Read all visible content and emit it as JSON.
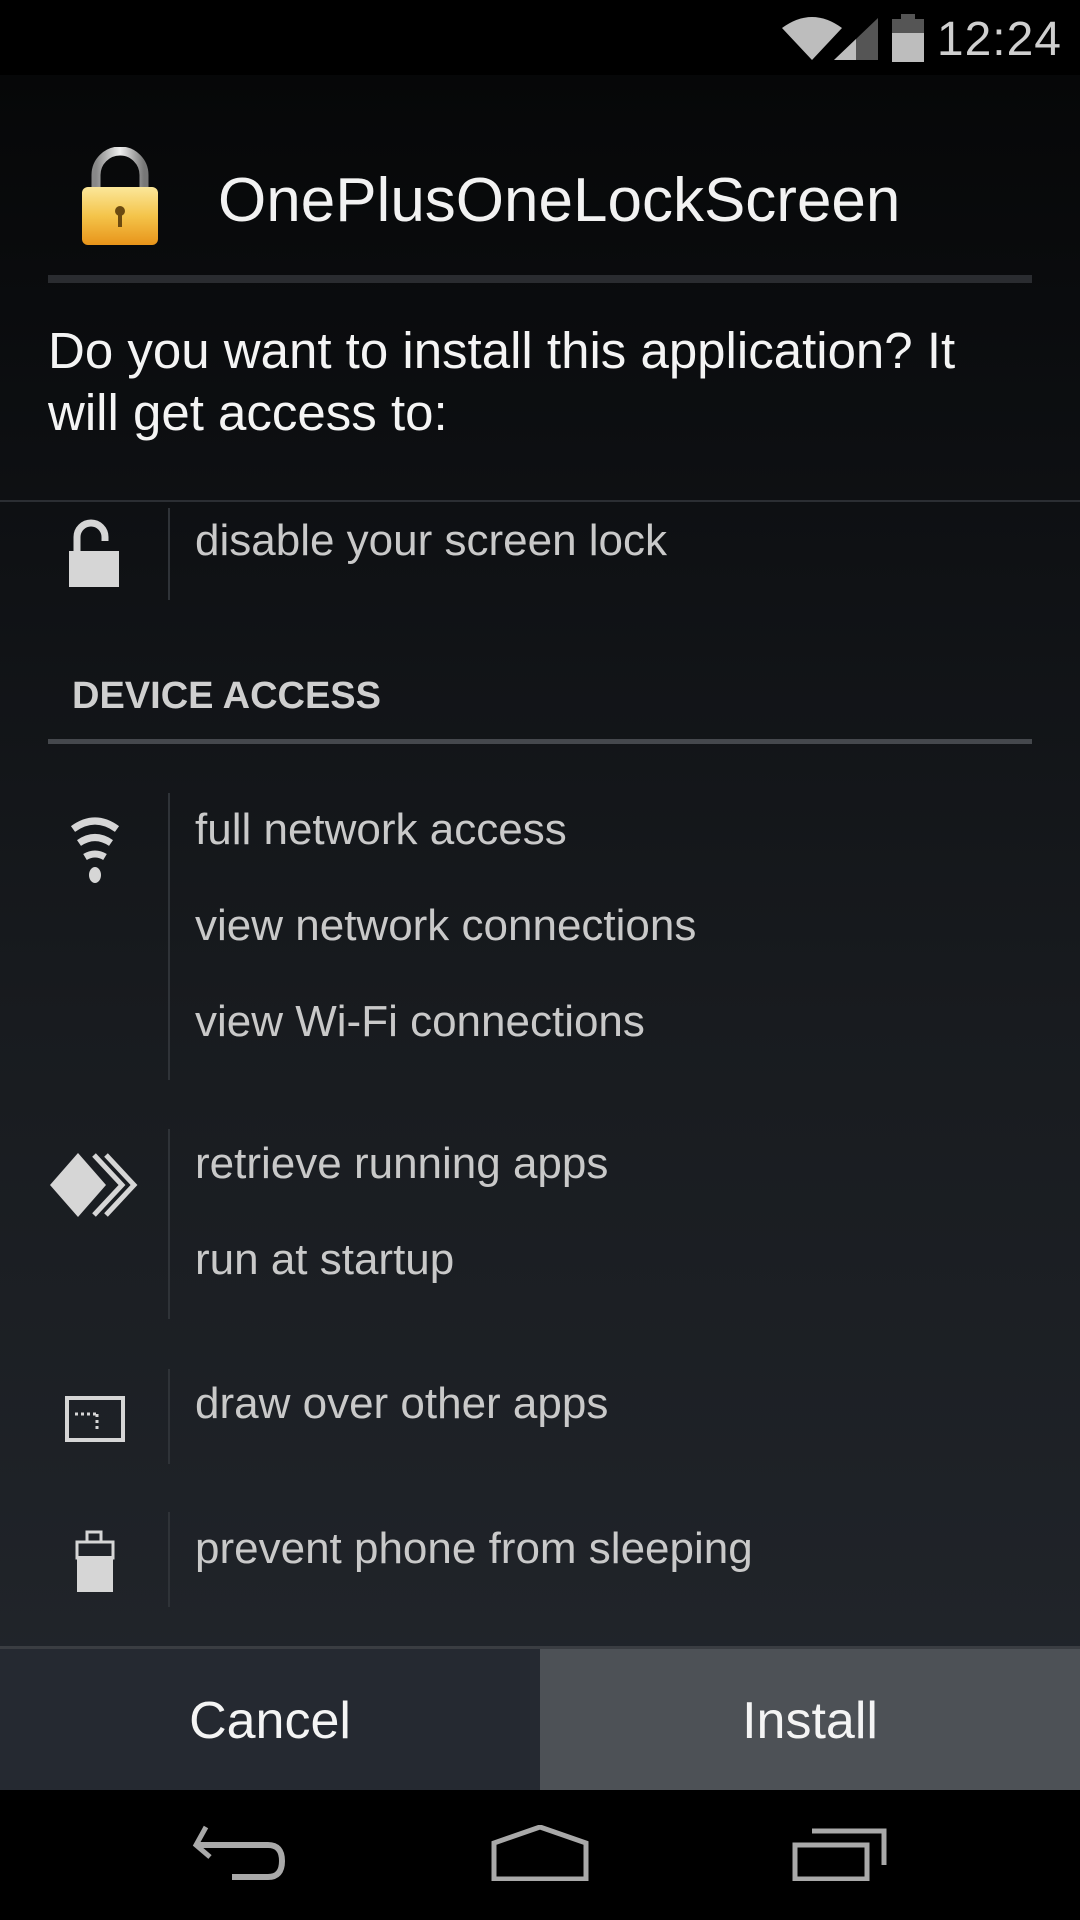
{
  "status_bar": {
    "time": "12:24",
    "icons": [
      "wifi-icon",
      "cell-signal-icon",
      "battery-icon"
    ]
  },
  "dialog": {
    "app_icon": "padlock-app-icon",
    "app_title": "OnePlusOneLockScreen",
    "question": "Do you want to install this application? It will get access to:",
    "permissions_top": [
      {
        "icon": "unlocked-padlock-icon",
        "items": [
          "disable your screen lock"
        ]
      }
    ],
    "section_header": "DEVICE ACCESS",
    "permission_groups": [
      {
        "icon": "wifi-icon",
        "items": [
          "full network access",
          "view network connections",
          "view Wi-Fi connections"
        ]
      },
      {
        "icon": "apps-chevron-icon",
        "items": [
          "retrieve running apps",
          "run at startup"
        ]
      },
      {
        "icon": "window-overlay-icon",
        "items": [
          "draw over other apps"
        ]
      },
      {
        "icon": "battery-icon",
        "items": [
          "prevent phone from sleeping"
        ]
      }
    ]
  },
  "buttons": {
    "cancel_label": "Cancel",
    "install_label": "Install"
  },
  "nav_bar": {
    "buttons": [
      "back",
      "home",
      "recents"
    ]
  },
  "colors": {
    "dialog_top": "#060708",
    "dialog_bottom": "#22262c",
    "cancel_bg": "#252931",
    "install_bg": "#4d5156",
    "text_primary": "#f4f4f4",
    "text_secondary": "#c9c9c9"
  }
}
